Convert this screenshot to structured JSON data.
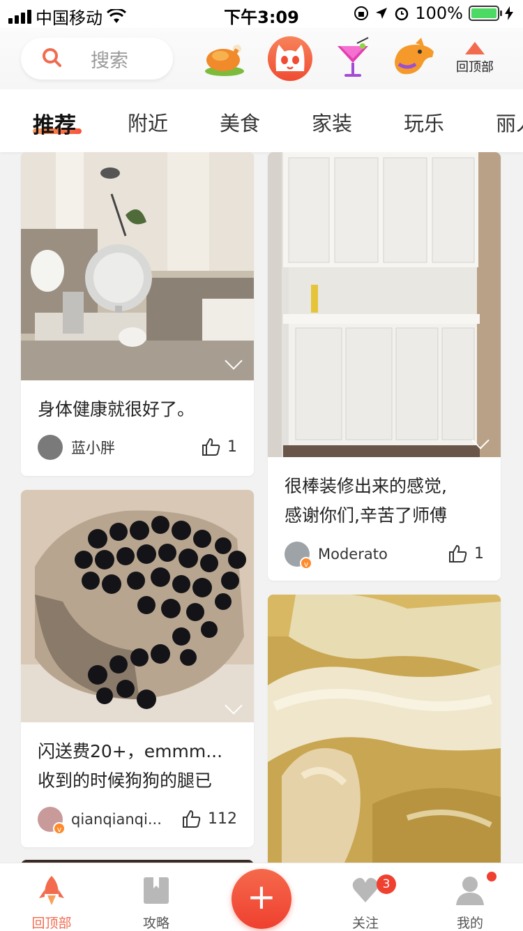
{
  "status_bar": {
    "carrier": "中国移动",
    "time": "下午3:09",
    "battery": "100%"
  },
  "header": {
    "search_placeholder": "搜索",
    "to_top_label": "回顶部"
  },
  "tabs": [
    {
      "label": "推荐",
      "active": true
    },
    {
      "label": "附近",
      "active": false
    },
    {
      "label": "美食",
      "active": false
    },
    {
      "label": "家装",
      "active": false
    },
    {
      "label": "玩乐",
      "active": false
    },
    {
      "label": "丽人",
      "active": false
    }
  ],
  "feed": {
    "cards": [
      {
        "title_lines": [
          "身体健康就很好了。"
        ],
        "author": "蓝小胖",
        "likes": "1"
      },
      {
        "title_lines": [
          "很棒装修出来的感觉,",
          "感谢你们,辛苦了师傅"
        ],
        "author": "Moderato",
        "likes": "1"
      },
      {
        "title_lines": [
          "闪送费20+，emmm...",
          "收到的时候狗狗的腿已"
        ],
        "author": "qianqianqi...",
        "likes": "112"
      },
      {
        "title_lines": [],
        "author": "",
        "likes": ""
      }
    ]
  },
  "bottom_nav": {
    "home": "回顶部",
    "guide": "攻略",
    "follow": "关注",
    "follow_badge": "3",
    "mine": "我的"
  },
  "colors": {
    "accent": "#f26b4f",
    "badge": "#ef4030"
  }
}
